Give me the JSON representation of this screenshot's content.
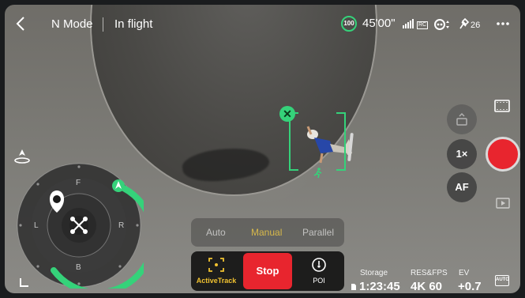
{
  "topbar": {
    "mode": "N Mode",
    "flight_status": "In flight",
    "battery": "100",
    "flight_time": "45'00\"",
    "rc_label": "RC",
    "satellites": "26"
  },
  "track": {
    "close_symbol": "✕"
  },
  "compass": {
    "front": "F",
    "back": "B",
    "left": "L",
    "right": "R"
  },
  "modes": {
    "items": [
      "Auto",
      "Manual",
      "Parallel"
    ],
    "selected": "Manual"
  },
  "actions": {
    "activetrack_label": "ActiveTrack",
    "stop_label": "Stop",
    "poi_label": "POI"
  },
  "camera": {
    "zoom": "1×",
    "focus": "AF",
    "auto_label": "AUTO"
  },
  "status": {
    "storage_label": "Storage",
    "storage_value": "1:23:45",
    "resfps_label": "RES&FPS",
    "resfps_value": "4K 60",
    "ev_label": "EV",
    "ev_value": "+0.7"
  },
  "colors": {
    "accent_green": "#35d27a",
    "record_red": "#e8252e",
    "activetrack_yellow": "#f1c230",
    "mode_selected": "#d7b84a"
  },
  "icons": [
    "back-icon",
    "signal-icon",
    "vision-icon",
    "satellite-icon",
    "more-icon",
    "takeoff-icon",
    "home-pin-icon",
    "drone-icon",
    "corner-icon",
    "film-icon",
    "play-icon",
    "camera-auto-icon",
    "runner-icon",
    "focus-bracket-icon",
    "poi-icon",
    "sd-card-icon"
  ]
}
